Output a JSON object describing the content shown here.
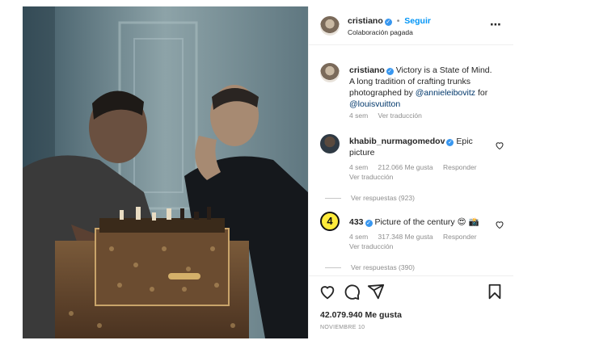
{
  "header": {
    "username": "cristiano",
    "separator": "•",
    "follow_label": "Seguir",
    "subtitle": "Colaboración pagada",
    "more_icon": "more-horizontal-icon"
  },
  "caption": {
    "username": "cristiano",
    "text_before": "Victory is a State of Mind. A long tradition of crafting trunks photographed by ",
    "mention_1": "@annieleibovitz",
    "text_mid": " for ",
    "mention_2": "@louisvuitton",
    "time": "4 sem",
    "translate": "Ver traducción"
  },
  "comments": [
    {
      "username": "khabib_nurmagomedov",
      "text": "Epic picture",
      "time": "4 sem",
      "likes": "212.066 Me gusta",
      "reply": "Responder",
      "translate": "Ver traducción",
      "replies": "Ver respuestas (923)"
    },
    {
      "username": "433",
      "avatar_text": "4",
      "text": "Picture of the century 😍 📸",
      "time": "4 sem",
      "likes": "317.348 Me gusta",
      "reply": "Responder",
      "translate": "Ver traducción",
      "replies": "Ver respuestas (390)"
    }
  ],
  "footer": {
    "likes": "42.079.940 Me gusta",
    "date": "NOVIEMBRE 10",
    "icons": [
      "heart-icon",
      "comment-icon",
      "share-icon",
      "save-icon"
    ]
  },
  "colors": {
    "accent": "#0095f6",
    "verified": "#3897f0",
    "muted": "#8e8e8e",
    "badge_433": "#ffeb3b"
  }
}
